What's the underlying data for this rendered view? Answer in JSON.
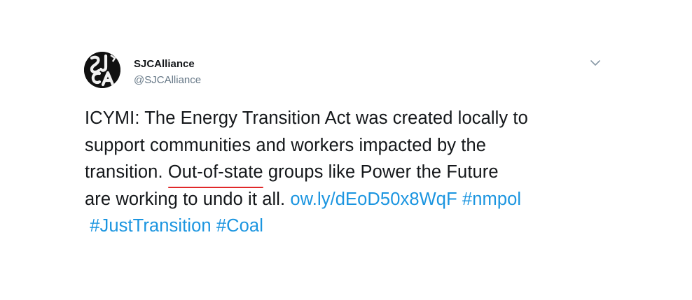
{
  "author": {
    "name": "SJCAlliance",
    "handle": "@SJCAlliance",
    "avatar_logo": "SJCA"
  },
  "tweet": {
    "line1": "ICYMI: The Energy Transition Act was created locally to",
    "line2": "support communities and workers impacted by the",
    "line3_before": "transition. ",
    "line3_underlined": "Out-of-state",
    "line3_after": " groups like Power the Future",
    "line4_text": "are working to undo it all. ",
    "link_url": "ow.ly/dEoD50x8WqF",
    "hashtag_1": "#nmpol",
    "hashtag_2": "#JustTransition",
    "hashtag_3": "#Coal"
  },
  "icons": {
    "menu": "chevron-down-icon"
  },
  "colors": {
    "link": "#1b95e0",
    "text": "#14171a",
    "handle": "#657786",
    "annotation_underline": "#e0282a",
    "avatar_bg": "#111111"
  }
}
